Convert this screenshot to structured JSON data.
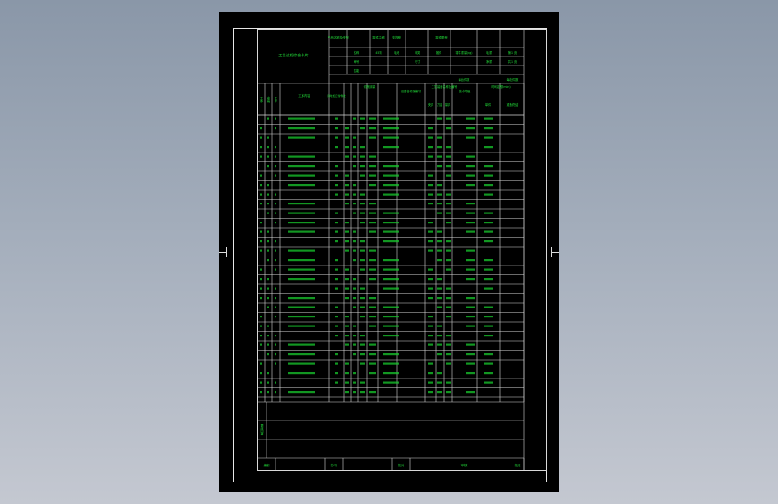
{
  "card": {
    "title": "工艺过程综合卡片",
    "product_label": "产品名称及型号",
    "part_name_label": "零件名称",
    "part_name": "支撑座",
    "part_no_label": "零件图号",
    "material_label": "名称",
    "material_value": "45钢",
    "blank_label": "毛坯",
    "kind_label": "种类",
    "kind_value": "锻件",
    "weight_label": "零件重量(kg)",
    "gross_label": "毛重",
    "net_label": "净重",
    "sheet_label": "第 1 页",
    "total_label": "共 1 页",
    "grade_label": "牌号",
    "size_label": "尺寸",
    "hardness_label": "性能",
    "per_part_label": "每台件数",
    "per_blank_label": "每批件数",
    "hdr_process": "工序",
    "hdr_setup": "安装",
    "hdr_step": "工步",
    "hdr_content": "工序内容",
    "hdr_parts": "同时加工零件数",
    "hdr_cutting": "切削用量",
    "hdr_machine": "设备名称及编号",
    "hdr_tools": "工艺装备名称及编号",
    "hdr_tech": "技术等级",
    "hdr_time": "时间定额(min)",
    "hdr_fixture": "夹具",
    "hdr_cutter": "刀具",
    "hdr_gauge": "量具",
    "hdr_unit": "单件",
    "hdr_prep": "准备终结",
    "remarks_label": "更改内容",
    "footer_drawn": "编制",
    "footer_check": "抄写",
    "footer_approve": "校对",
    "footer_review": "审核",
    "footer_final": "批准"
  }
}
